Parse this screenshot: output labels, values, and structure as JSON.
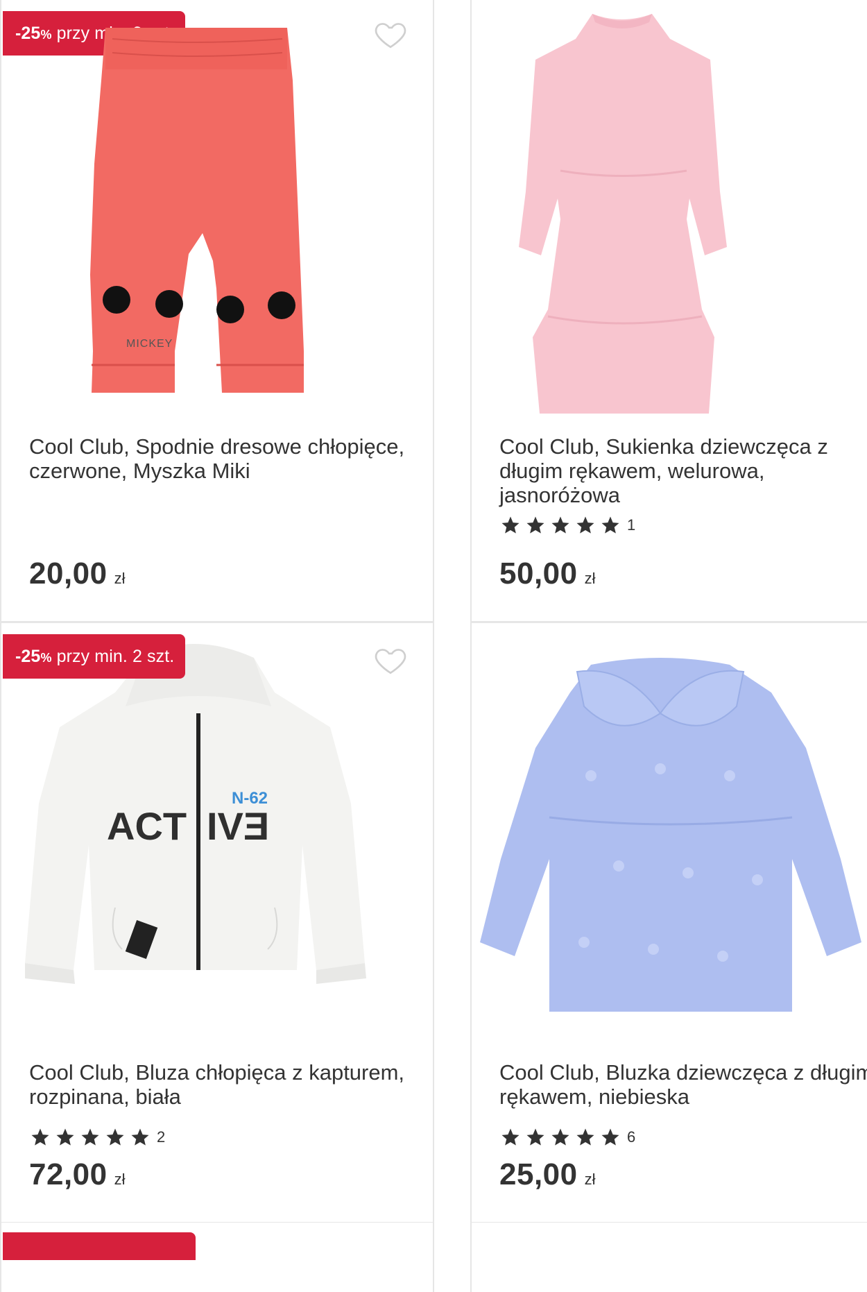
{
  "products": [
    {
      "badge_pct": "-25",
      "badge_pct_sign": "%",
      "badge_text": " przy min. 2 szt.",
      "title": "Cool Club, Spodnie dresowe chłopięce, czerwone, Myszka Miki",
      "rating_count": "",
      "price": "20,00",
      "currency": "zł",
      "image_print": "MICKEY",
      "colors": {
        "garment": "#f26a63"
      }
    },
    {
      "badge_pct": "",
      "badge_pct_sign": "",
      "badge_text": "",
      "title": "Cool Club, Sukienka dziewczęca z długim rękawem, welurowa, jasnoróżowa",
      "rating_count": "1",
      "price": "50,00",
      "currency": "zł",
      "colors": {
        "garment": "#f8c5cf"
      }
    },
    {
      "badge_pct": "-25",
      "badge_pct_sign": "%",
      "badge_text": " przy min. 2 szt.",
      "title": "Cool Club, Bluza chłopięca z kapturem, rozpinana, biała",
      "rating_count": "2",
      "price": "72,00",
      "currency": "zł",
      "image_print_left": "ACT",
      "image_print_right": "IVƎ",
      "image_print_code": "N-62",
      "colors": {
        "garment": "#f3f3f1"
      }
    },
    {
      "badge_pct": "",
      "badge_pct_sign": "",
      "badge_text": "",
      "title": "Cool Club, Bluzka dziewczęca z długim rękawem, niebieska",
      "rating_count": "6",
      "price": "25,00",
      "currency": "zł",
      "colors": {
        "garment": "#aebef0"
      }
    }
  ],
  "theme": {
    "badge_color": "#d6203c",
    "star_color": "#333333",
    "heart_icon": "heart-outline-icon",
    "star_icon": "star-filled-icon"
  }
}
